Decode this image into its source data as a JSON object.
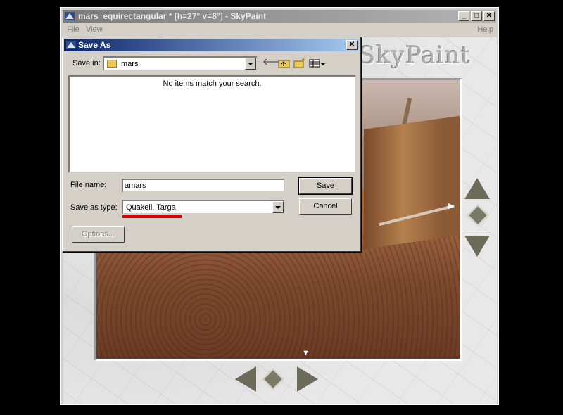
{
  "main_window": {
    "title": "mars_equirectangular *  [h=27° v=8°] - SkyPaint",
    "menu": [
      "File",
      "View"
    ],
    "help": "Help",
    "caption": {
      "minimize": "_",
      "maximize": "□",
      "close": "✕"
    }
  },
  "logo": "SkyPaint",
  "dialog": {
    "title": "Save As",
    "close": "✕",
    "save_in_label": "Save in:",
    "save_in_value": "mars",
    "toolbar": [
      "back-arrow-icon",
      "up-folder-icon",
      "new-folder-icon",
      "view-menu-icon"
    ],
    "empty_message": "No items match your search.",
    "file_name_label": "File name:",
    "file_name_value": "amars",
    "save_type_label": "Save as type:",
    "save_type_value": "Quakell, Targa",
    "save_button": "Save",
    "cancel_button": "Cancel",
    "options_button": "Options..."
  },
  "colors": {
    "dialog_title_start": "#0a246a",
    "dialog_title_end": "#a6caf0",
    "highlight_underline": "#e00000"
  }
}
